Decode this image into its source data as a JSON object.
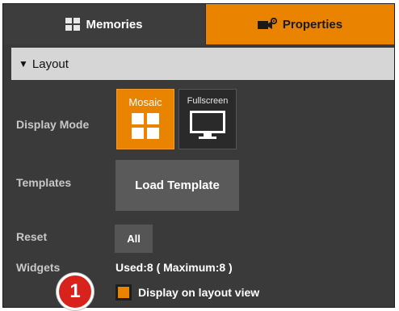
{
  "tabs": {
    "memories": {
      "label": "Memories",
      "icon": "grid-icon"
    },
    "properties": {
      "label": "Properties",
      "icon": "camera-gear-icon",
      "active": true
    }
  },
  "section": {
    "title": "Layout",
    "caret": "▼",
    "expanded": true
  },
  "display_mode": {
    "label": "Display Mode",
    "options": [
      {
        "label": "Mosaic",
        "icon": "mosaic-icon",
        "selected": true
      },
      {
        "label": "Fullscreen",
        "icon": "monitor-icon",
        "selected": false
      }
    ]
  },
  "templates": {
    "label": "Templates",
    "button": "Load Template"
  },
  "reset": {
    "label": "Reset",
    "button": "All"
  },
  "widgets": {
    "label": "Widgets",
    "usage": "Used:8 ( Maximum:8 )",
    "checkbox_label": "Display on layout view",
    "checked": true
  },
  "callout": {
    "number": "1"
  },
  "colors": {
    "accent": "#e98300",
    "panel": "#3a3a3a",
    "header": "#d6d6d6",
    "callout": "#d8231c"
  }
}
